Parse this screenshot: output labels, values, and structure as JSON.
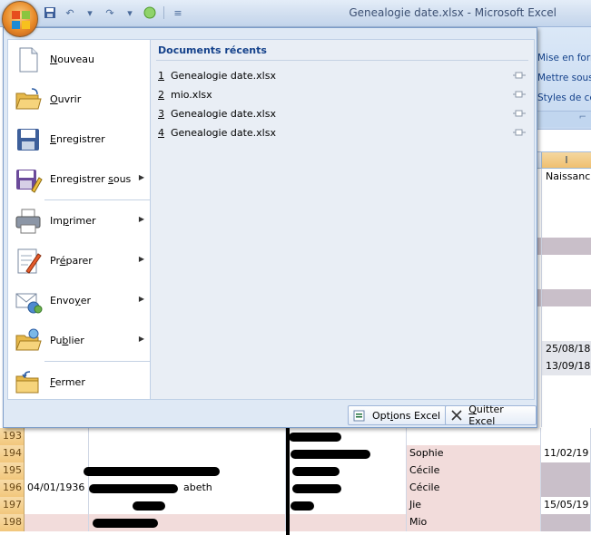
{
  "window": {
    "title": "Genealogie date.xlsx - Microsoft Excel"
  },
  "ribbon": {
    "items": [
      "Mise en form",
      "Mettre sous",
      "Styles de cel"
    ],
    "column_header": "I",
    "header_cell": "Naissanc"
  },
  "menu": {
    "items": [
      {
        "label_prefix": "",
        "mnemonic": "N",
        "label_suffix": "ouveau",
        "has_submenu": false,
        "icon": "new-document-icon"
      },
      {
        "label_prefix": "",
        "mnemonic": "O",
        "label_suffix": "uvrir",
        "has_submenu": false,
        "icon": "open-folder-icon"
      },
      {
        "label_prefix": "",
        "mnemonic": "E",
        "label_suffix": "nregistrer",
        "has_submenu": false,
        "icon": "save-icon"
      },
      {
        "label_prefix": "Enregistrer ",
        "mnemonic": "s",
        "label_suffix": "ous",
        "has_submenu": true,
        "icon": "save-as-icon"
      },
      {
        "label_prefix": "Im",
        "mnemonic": "p",
        "label_suffix": "rimer",
        "has_submenu": true,
        "icon": "printer-icon"
      },
      {
        "label_prefix": "Pr",
        "mnemonic": "é",
        "label_suffix": "parer",
        "has_submenu": true,
        "icon": "prepare-icon"
      },
      {
        "label_prefix": "Envo",
        "mnemonic": "y",
        "label_suffix": "er",
        "has_submenu": true,
        "icon": "send-icon"
      },
      {
        "label_prefix": "Pu",
        "mnemonic": "b",
        "label_suffix": "lier",
        "has_submenu": true,
        "icon": "publish-icon"
      },
      {
        "label_prefix": "",
        "mnemonic": "F",
        "label_suffix": "ermer",
        "has_submenu": false,
        "icon": "close-folder-icon"
      }
    ],
    "recent": {
      "header": "Documents récents",
      "files": [
        {
          "num": "1",
          "name": "Genealogie date.xlsx"
        },
        {
          "num": "2",
          "name": "mio.xlsx"
        },
        {
          "num": "3",
          "name": "Genealogie date.xlsx"
        },
        {
          "num": "4",
          "name": "Genealogie date.xlsx"
        }
      ]
    },
    "footer": {
      "options": {
        "prefix": "Opt",
        "mnemonic": "i",
        "suffix": "ons Excel"
      },
      "quit": {
        "prefix": "",
        "mnemonic": "Q",
        "suffix": "uitter Excel"
      }
    }
  },
  "sheet": {
    "right_cells": [
      "Naissanc",
      "",
      "",
      "",
      "",
      "",
      "",
      "",
      "",
      "",
      "25/08/18",
      "13/09/18",
      "",
      "",
      ""
    ],
    "rows": [
      {
        "num": "193",
        "a": "",
        "e": "",
        "i": ""
      },
      {
        "num": "194",
        "a": "",
        "e": "Sophie",
        "i": "11/02/19"
      },
      {
        "num": "195",
        "a": "",
        "e": "Cécile",
        "i": ""
      },
      {
        "num": "196",
        "a": "04/01/1936",
        "b": "abeth",
        "e": "Cécile",
        "i": ""
      },
      {
        "num": "197",
        "a": "",
        "e": "Jie",
        "i": "15/05/19"
      },
      {
        "num": "198",
        "a": "",
        "e": "Mio",
        "i": ""
      }
    ]
  },
  "colors": {
    "accent": "#15428b",
    "row_pink": "#f2dcdb",
    "row_header": "#f2c77c"
  }
}
